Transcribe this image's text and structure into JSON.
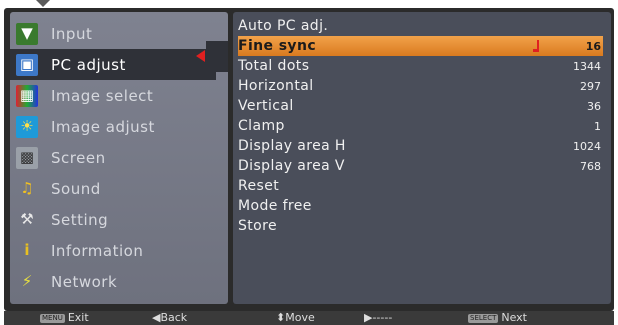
{
  "sidebar": {
    "items": [
      {
        "label": "Input",
        "icon": "input-icon"
      },
      {
        "label": "PC adjust",
        "icon": "pc-adjust-icon"
      },
      {
        "label": "Image select",
        "icon": "image-select-icon"
      },
      {
        "label": "Image adjust",
        "icon": "image-adjust-icon"
      },
      {
        "label": "Screen",
        "icon": "screen-icon"
      },
      {
        "label": "Sound",
        "icon": "sound-icon"
      },
      {
        "label": "Setting",
        "icon": "setting-icon"
      },
      {
        "label": "Information",
        "icon": "information-icon"
      },
      {
        "label": "Network",
        "icon": "network-icon"
      }
    ],
    "active_index": 1
  },
  "menu": {
    "rows": [
      {
        "label": "Auto PC adj.",
        "value": ""
      },
      {
        "label": "Fine sync",
        "value": "16"
      },
      {
        "label": "Total dots",
        "value": "1344"
      },
      {
        "label": "Horizontal",
        "value": "297"
      },
      {
        "label": "Vertical",
        "value": "36"
      },
      {
        "label": "Clamp",
        "value": "1"
      },
      {
        "label": "Display area H",
        "value": "1024"
      },
      {
        "label": "Display area V",
        "value": "768"
      },
      {
        "label": "Reset",
        "value": ""
      },
      {
        "label": "Mode free",
        "value": ""
      },
      {
        "label": "Store",
        "value": ""
      }
    ],
    "selected_index": 1
  },
  "footer": {
    "exit_tag": "MENU",
    "exit_label": "Exit",
    "back_label": "◀Back",
    "move_label": "⬍Move",
    "dash_label": "▶-----",
    "next_tag": "SELECT",
    "next_label": "Next"
  },
  "colors": {
    "accent": "#e8912f",
    "active_arrow": "#e02020"
  }
}
